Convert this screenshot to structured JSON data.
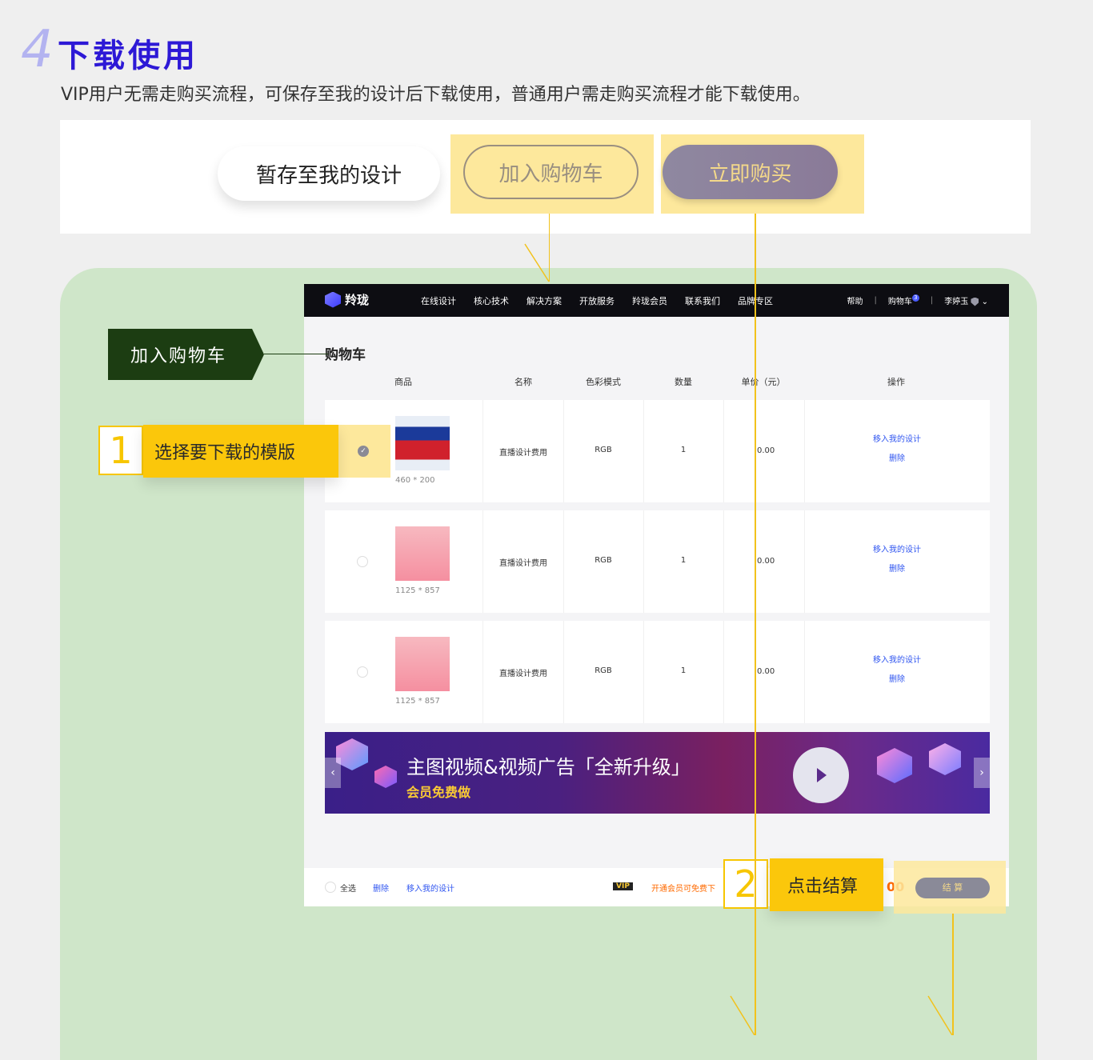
{
  "step": {
    "number": "4",
    "title": "下载使用",
    "desc": "VIP用户无需走购买流程，可保存至我的设计后下载使用，普通用户需走购买流程才能下载使用。"
  },
  "buttons": {
    "save": "暂存至我的设计",
    "add_cart": "加入购物车",
    "buy_now": "立即购买"
  },
  "tag_add_cart": "加入购物车",
  "nav": {
    "logo": "羚珑",
    "menu": [
      "在线设计",
      "核心技术",
      "解决方案",
      "开放服务",
      "羚珑会员",
      "联系我们",
      "品牌专区"
    ],
    "help": "帮助",
    "cart": "购物车",
    "cart_count": "3",
    "user": "李婷玉"
  },
  "cart": {
    "title": "购物车",
    "headers": [
      "商品",
      "名称",
      "色彩模式",
      "数量",
      "单价（元）",
      "操作"
    ],
    "rows": [
      {
        "size": "460 * 200",
        "name": "直播设计费用",
        "color_mode": "RGB",
        "qty": "1",
        "price": "0.00",
        "op1": "移入我的设计",
        "op2": "删除",
        "checked": true
      },
      {
        "size": "1125 * 857",
        "name": "直播设计费用",
        "color_mode": "RGB",
        "qty": "1",
        "price": "0.00",
        "op1": "移入我的设计",
        "op2": "删除",
        "checked": false
      },
      {
        "size": "1125 * 857",
        "name": "直播设计费用",
        "color_mode": "RGB",
        "qty": "1",
        "price": "0.00",
        "op1": "移入我的设计",
        "op2": "删除",
        "checked": false
      }
    ]
  },
  "banner": {
    "title": "主图视频&视频广告「全新升级」",
    "subtitle": "会员免费做",
    "prev": "‹",
    "next": "›"
  },
  "footer": {
    "select_all": "全选",
    "delete": "删除",
    "move": "移入我的设计",
    "vip": "VIP",
    "vip_text": "开通会员可免费下",
    "total_frag": "00",
    "settle": "结 算"
  },
  "step1": {
    "num": "1",
    "label": "选择要下载的模版"
  },
  "step2": {
    "num": "2",
    "label": "点击结算"
  }
}
